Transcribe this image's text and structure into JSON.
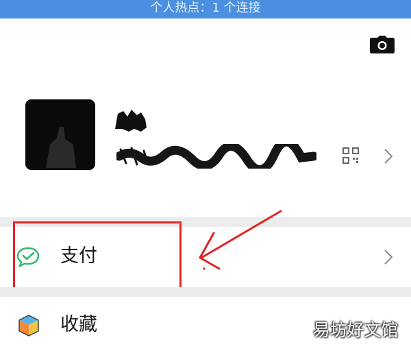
{
  "status_bar": {
    "text": "个人热点：1 个连接"
  },
  "profile": {
    "avatar_icon": "avatar-redacted",
    "camera_icon": "camera-icon",
    "qrcode_icon": "qrcode-icon",
    "chevron_icon": "chevron-right-icon"
  },
  "menu": {
    "items": [
      {
        "label": "支付",
        "icon": "wechat-pay-icon"
      },
      {
        "label": "收藏",
        "icon": "favorites-cube-icon"
      }
    ]
  },
  "watermark": {
    "text": "易坊好文馆"
  },
  "colors": {
    "status_bar": "#4a8fe0",
    "highlight": "#e02424",
    "divider": "#ececec",
    "pay_green": "#2fb86b"
  }
}
